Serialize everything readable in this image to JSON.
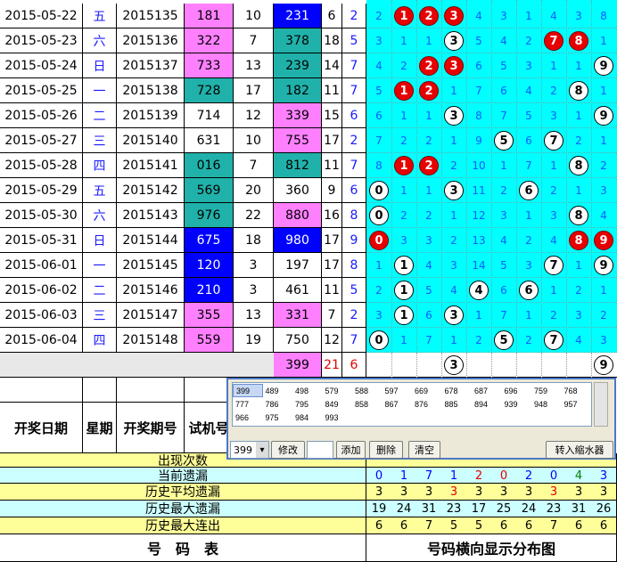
{
  "rows": [
    {
      "date": "2015-05-22",
      "week": "五",
      "issue": "2015135",
      "kaijiang": "181",
      "kj_bg": "#ff80ff",
      "kj_fg": "#000000",
      "span": "10",
      "shiji": "231",
      "sj_bg": "#0000ff",
      "sj_fg": "#ffffff",
      "sum": "6",
      "tail": "2",
      "cells": [
        "2",
        "1",
        "2",
        "3",
        "4",
        "3",
        "1",
        "4",
        "3",
        "8"
      ],
      "balls": {
        "1": "r",
        "2": "r",
        "3": "r"
      }
    },
    {
      "date": "2015-05-23",
      "week": "六",
      "issue": "2015136",
      "kaijiang": "322",
      "kj_bg": "#ff80ff",
      "kj_fg": "#000000",
      "span": "7",
      "shiji": "378",
      "sj_bg": "#20b2aa",
      "sj_fg": "#000000",
      "sum": "18",
      "tail": "5",
      "cells": [
        "3",
        "1",
        "1",
        "3",
        "5",
        "4",
        "2",
        "7",
        "8",
        "1"
      ],
      "balls": {
        "3": "w",
        "7": "r",
        "8": "r"
      }
    },
    {
      "date": "2015-05-24",
      "week": "日",
      "issue": "2015137",
      "kaijiang": "733",
      "kj_bg": "#ff80ff",
      "kj_fg": "#000000",
      "span": "13",
      "shiji": "239",
      "sj_bg": "#20b2aa",
      "sj_fg": "#000000",
      "sum": "14",
      "tail": "7",
      "cells": [
        "4",
        "2",
        "2",
        "3",
        "6",
        "5",
        "3",
        "1",
        "1",
        "9"
      ],
      "balls": {
        "2": "r",
        "3": "r",
        "9": "w"
      }
    },
    {
      "date": "2015-05-25",
      "week": "一",
      "issue": "2015138",
      "kaijiang": "728",
      "kj_bg": "#20b2aa",
      "kj_fg": "#000000",
      "span": "17",
      "shiji": "182",
      "sj_bg": "#20b2aa",
      "sj_fg": "#000000",
      "sum": "11",
      "tail": "7",
      "cells": [
        "5",
        "1",
        "2",
        "1",
        "7",
        "6",
        "4",
        "2",
        "8",
        "1"
      ],
      "balls": {
        "1": "r",
        "2": "r",
        "8": "w"
      }
    },
    {
      "date": "2015-05-26",
      "week": "二",
      "issue": "2015139",
      "kaijiang": "714",
      "kj_bg": "#ffffff",
      "kj_fg": "#000000",
      "span": "12",
      "shiji": "339",
      "sj_bg": "#ff80ff",
      "sj_fg": "#000000",
      "sum": "15",
      "tail": "6",
      "cells": [
        "6",
        "1",
        "1",
        "3",
        "8",
        "7",
        "5",
        "3",
        "1",
        "9"
      ],
      "balls": {
        "3": "w",
        "9": "w"
      }
    },
    {
      "date": "2015-05-27",
      "week": "三",
      "issue": "2015140",
      "kaijiang": "631",
      "kj_bg": "#ffffff",
      "kj_fg": "#000000",
      "span": "10",
      "shiji": "755",
      "sj_bg": "#ff80ff",
      "sj_fg": "#000000",
      "sum": "17",
      "tail": "2",
      "cells": [
        "7",
        "2",
        "2",
        "1",
        "9",
        "5",
        "6",
        "7",
        "2",
        "1"
      ],
      "balls": {
        "5": "w",
        "7": "w"
      }
    },
    {
      "date": "2015-05-28",
      "week": "四",
      "issue": "2015141",
      "kaijiang": "016",
      "kj_bg": "#20b2aa",
      "kj_fg": "#000000",
      "span": "7",
      "shiji": "812",
      "sj_bg": "#20b2aa",
      "sj_fg": "#000000",
      "sum": "11",
      "tail": "7",
      "cells": [
        "8",
        "1",
        "2",
        "2",
        "10",
        "1",
        "7",
        "1",
        "8",
        "2"
      ],
      "balls": {
        "1": "r",
        "2": "r",
        "8": "w"
      }
    },
    {
      "date": "2015-05-29",
      "week": "五",
      "issue": "2015142",
      "kaijiang": "569",
      "kj_bg": "#20b2aa",
      "kj_fg": "#000000",
      "span": "20",
      "shiji": "360",
      "sj_bg": "#ffffff",
      "sj_fg": "#000000",
      "sum": "9",
      "tail": "6",
      "cells": [
        "0",
        "1",
        "1",
        "3",
        "11",
        "2",
        "6",
        "2",
        "1",
        "3"
      ],
      "balls": {
        "0": "w",
        "3": "w",
        "6": "w"
      }
    },
    {
      "date": "2015-05-30",
      "week": "六",
      "issue": "2015143",
      "kaijiang": "976",
      "kj_bg": "#20b2aa",
      "kj_fg": "#000000",
      "span": "22",
      "shiji": "880",
      "sj_bg": "#ff80ff",
      "sj_fg": "#000000",
      "sum": "16",
      "tail": "8",
      "cells": [
        "0",
        "2",
        "2",
        "1",
        "12",
        "3",
        "1",
        "3",
        "8",
        "4"
      ],
      "balls": {
        "0": "w",
        "8": "w"
      }
    },
    {
      "date": "2015-05-31",
      "week": "日",
      "issue": "2015144",
      "kaijiang": "675",
      "kj_bg": "#0000ff",
      "kj_fg": "#ffffff",
      "span": "18",
      "shiji": "980",
      "sj_bg": "#0000ff",
      "sj_fg": "#ffffff",
      "sum": "17",
      "tail": "9",
      "cells": [
        "0",
        "3",
        "3",
        "2",
        "13",
        "4",
        "2",
        "4",
        "8",
        "9"
      ],
      "balls": {
        "0": "r",
        "8": "r",
        "9": "r"
      }
    },
    {
      "date": "2015-06-01",
      "week": "一",
      "issue": "2015145",
      "kaijiang": "120",
      "kj_bg": "#0000ff",
      "kj_fg": "#ffffff",
      "span": "3",
      "shiji": "197",
      "sj_bg": "#ffffff",
      "sj_fg": "#000000",
      "sum": "17",
      "tail": "8",
      "cells": [
        "1",
        "1",
        "4",
        "3",
        "14",
        "5",
        "3",
        "7",
        "1",
        "9"
      ],
      "balls": {
        "1": "w",
        "7": "w",
        "9": "w"
      }
    },
    {
      "date": "2015-06-02",
      "week": "二",
      "issue": "2015146",
      "kaijiang": "210",
      "kj_bg": "#0000ff",
      "kj_fg": "#ffffff",
      "span": "3",
      "shiji": "461",
      "sj_bg": "#ffffff",
      "sj_fg": "#000000",
      "sum": "11",
      "tail": "5",
      "cells": [
        "2",
        "1",
        "5",
        "4",
        "4",
        "6",
        "6",
        "1",
        "2",
        "1"
      ],
      "balls": {
        "1": "w",
        "4": "w",
        "6": "w"
      }
    },
    {
      "date": "2015-06-03",
      "week": "三",
      "issue": "2015147",
      "kaijiang": "355",
      "kj_bg": "#ff80ff",
      "kj_fg": "#000000",
      "span": "13",
      "shiji": "331",
      "sj_bg": "#ff80ff",
      "sj_fg": "#000000",
      "sum": "7",
      "tail": "2",
      "cells": [
        "3",
        "1",
        "6",
        "3",
        "1",
        "7",
        "1",
        "2",
        "3",
        "2"
      ],
      "balls": {
        "1": "w",
        "3": "w"
      }
    },
    {
      "date": "2015-06-04",
      "week": "四",
      "issue": "2015148",
      "kaijiang": "559",
      "kj_bg": "#ff80ff",
      "kj_fg": "#000000",
      "span": "19",
      "shiji": "750",
      "sj_bg": "#ffffff",
      "sj_fg": "#000000",
      "sum": "12",
      "tail": "7",
      "cells": [
        "0",
        "1",
        "7",
        "1",
        "2",
        "5",
        "2",
        "7",
        "4",
        "3"
      ],
      "balls": {
        "0": "w",
        "5": "w",
        "7": "w"
      }
    }
  ],
  "next": {
    "shiji": "399",
    "sum": "21",
    "tail": "6",
    "balls": [
      "3",
      "9"
    ]
  },
  "header": {
    "date": "开奖日期",
    "week": "星期",
    "issue": "开奖期号",
    "shiji": "试机号"
  },
  "stats": {
    "labels": [
      "出现次数",
      "当前遗漏",
      "历史平均遗漏",
      "历史最大遗漏",
      "历史最大连出"
    ],
    "current": [
      "0",
      "1",
      "7",
      "1",
      "2",
      "0",
      "2",
      "0",
      "4",
      "3"
    ],
    "avg": [
      "3",
      "3",
      "3",
      "3",
      "3",
      "3",
      "3",
      "3",
      "3",
      "3"
    ],
    "maxmiss": [
      "19",
      "24",
      "31",
      "23",
      "17",
      "25",
      "24",
      "23",
      "31",
      "26"
    ],
    "maxrun": [
      "6",
      "6",
      "7",
      "5",
      "5",
      "6",
      "6",
      "7",
      "6",
      "6"
    ]
  },
  "footer": {
    "left": "号　码　表",
    "right": "号码横向显示分布图"
  },
  "panel": {
    "combos": [
      "399",
      "489",
      "498",
      "579",
      "588",
      "597",
      "669",
      "678",
      "687",
      "696",
      "759",
      "768",
      "777",
      "786",
      "795",
      "849",
      "858",
      "867",
      "876",
      "885",
      "894",
      "939",
      "948",
      "957",
      "966",
      "975",
      "984",
      "993"
    ],
    "select_value": "399",
    "btn_modify": "修改",
    "btn_add": "添加",
    "btn_delete": "删除",
    "btn_clear": "清空",
    "btn_transfer": "转入缩水器"
  }
}
